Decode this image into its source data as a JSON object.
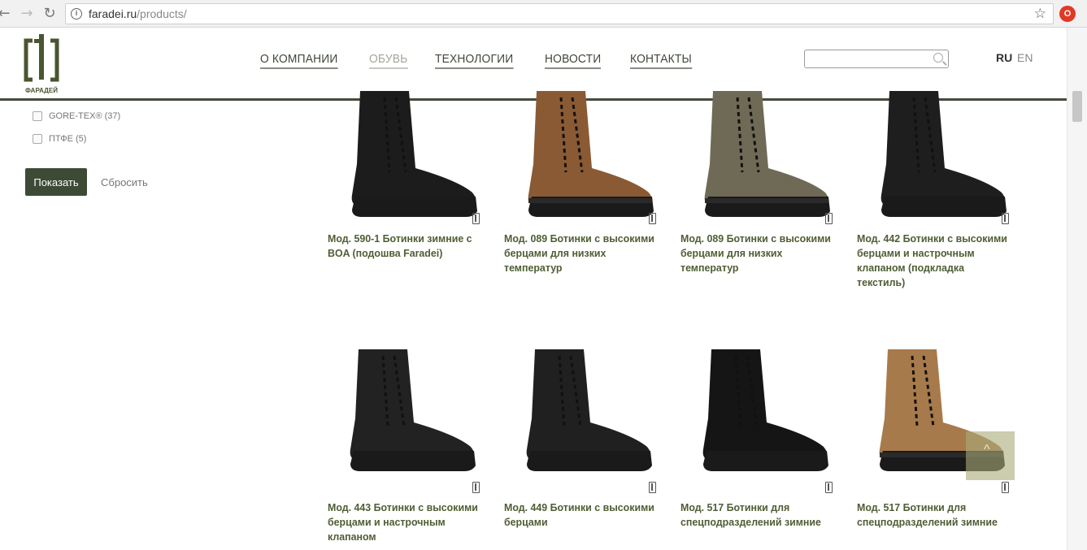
{
  "browser": {
    "url_host": "faradei.ru",
    "url_path": "/products/"
  },
  "header": {
    "logo_text": "ФАРАДЕЙ",
    "nav": [
      {
        "label": "О КОМПАНИИ",
        "active": false
      },
      {
        "label": "ОБУВЬ",
        "active": true
      },
      {
        "label": "ТЕХНОЛОГИИ",
        "active": false
      },
      {
        "label": "НОВОСТИ",
        "active": false
      },
      {
        "label": "КОНТАКТЫ",
        "active": false
      }
    ],
    "search_value": "",
    "lang_ru": "RU",
    "lang_en": "EN"
  },
  "filters": {
    "items": [
      {
        "label": "GORE-TEX® (37)"
      },
      {
        "label": "ПТФЕ (5)"
      }
    ],
    "show_label": "Показать",
    "reset_label": "Сбросить"
  },
  "products": [
    {
      "title": "Мод. 590-1 Ботинки зимние с BOA (подошва Faradei)",
      "color": "#1c1c1c"
    },
    {
      "title": "Мод. 089 Ботинки с высокими берцами для низких температур",
      "color": "#8a5a34"
    },
    {
      "title": "Мод. 089 Ботинки с высокими берцами для низких температур",
      "color": "#6f6a55"
    },
    {
      "title": "Мод. 442 Ботинки с высокими берцами и настрочным клапаном (подкладка текстиль)",
      "color": "#1e1e1e"
    },
    {
      "title": "Мод. 443 Ботинки с высокими берцами и настрочным клапаном",
      "color": "#222222"
    },
    {
      "title": "Мод. 449 Ботинки с высокими берцами",
      "color": "#202020"
    },
    {
      "title": "Мод. 517 Ботинки для спецподразделений зимние",
      "color": "#151515"
    },
    {
      "title": "Мод. 517 Ботинки для спецподразделений зимние",
      "color": "#a77a4b"
    }
  ],
  "colors": {
    "accent": "#434c3b",
    "title": "#4f5e34"
  }
}
